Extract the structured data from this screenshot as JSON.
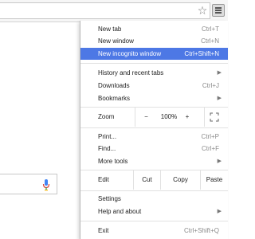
{
  "menu": {
    "new_tab": {
      "label": "New tab",
      "shortcut": "Ctrl+T"
    },
    "new_window": {
      "label": "New window",
      "shortcut": "Ctrl+N"
    },
    "new_incognito": {
      "label": "New incognito window",
      "shortcut": "Ctrl+Shift+N"
    },
    "history": {
      "label": "History and recent tabs"
    },
    "downloads": {
      "label": "Downloads",
      "shortcut": "Ctrl+J"
    },
    "bookmarks": {
      "label": "Bookmarks"
    },
    "zoom": {
      "label": "Zoom",
      "minus": "−",
      "value": "100%",
      "plus": "+"
    },
    "print": {
      "label": "Print...",
      "shortcut": "Ctrl+P"
    },
    "find": {
      "label": "Find...",
      "shortcut": "Ctrl+F"
    },
    "more_tools": {
      "label": "More tools"
    },
    "edit": {
      "label": "Edit",
      "cut": "Cut",
      "copy": "Copy",
      "paste": "Paste"
    },
    "settings": {
      "label": "Settings"
    },
    "help": {
      "label": "Help and about"
    },
    "exit": {
      "label": "Exit",
      "shortcut": "Ctrl+Shift+Q"
    }
  },
  "colors": {
    "highlight": "#4d78e5",
    "mic_blue": "#4285f4",
    "mic_red": "#db4437"
  }
}
